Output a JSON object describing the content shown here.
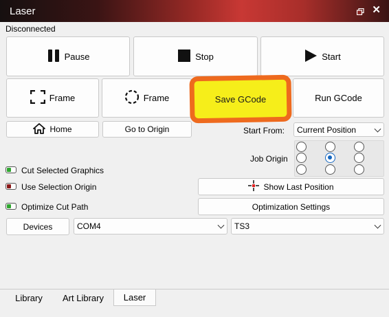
{
  "window": {
    "title": "Laser"
  },
  "status": "Disconnected",
  "buttons": {
    "pause": "Pause",
    "stop": "Stop",
    "start": "Start",
    "frame_rect": "Frame",
    "frame_circle": "Frame",
    "save_gcode": "Save GCode",
    "run_gcode": "Run GCode",
    "home": "Home",
    "go_to_origin": "Go to Origin",
    "show_last_position": "Show Last Position",
    "optimization_settings": "Optimization Settings",
    "devices": "Devices"
  },
  "start_from": {
    "label": "Start From:",
    "value": "Current Position"
  },
  "job_origin": {
    "label": "Job Origin",
    "selected": "middle-center"
  },
  "toggles": [
    {
      "label": "Cut Selected Graphics",
      "on": true
    },
    {
      "label": "Use Selection Origin",
      "on": false
    },
    {
      "label": "Optimize Cut Path",
      "on": true
    }
  ],
  "port_select": {
    "value": "COM4"
  },
  "device_select": {
    "value": "TS3"
  },
  "tabs": [
    {
      "label": "Library",
      "active": false
    },
    {
      "label": "Art Library",
      "active": false
    },
    {
      "label": "Laser",
      "active": true
    }
  ],
  "colors": {
    "highlight_fill": "#f6ee1a",
    "highlight_border": "#ee6a1e",
    "radio_accent": "#1466c0"
  }
}
